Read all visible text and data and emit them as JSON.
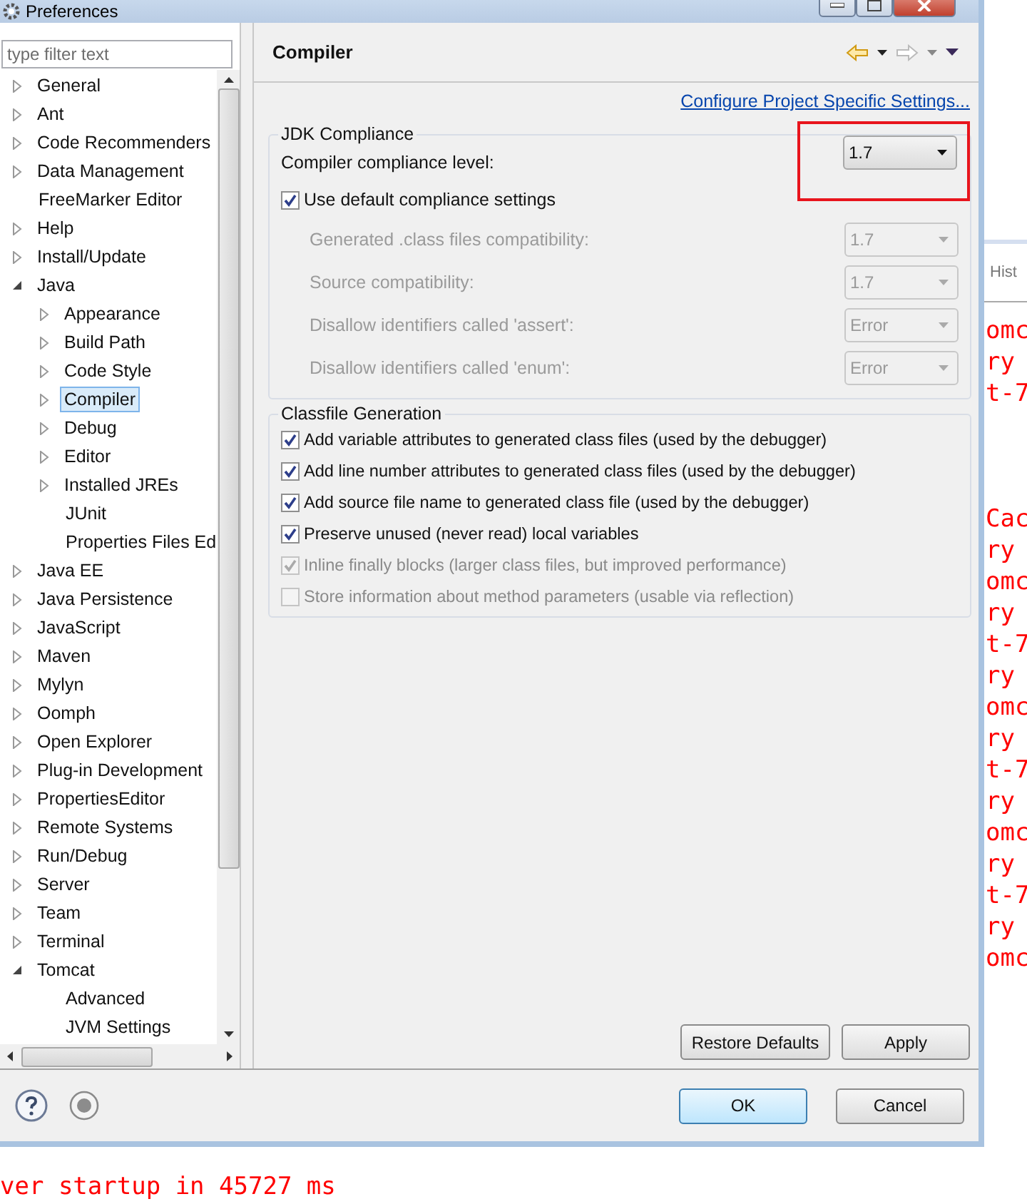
{
  "window": {
    "title": "Preferences"
  },
  "filter": {
    "placeholder": "type filter text"
  },
  "tree": [
    {
      "label": "General",
      "expanded": false,
      "selected": false
    },
    {
      "label": "Ant",
      "expanded": false,
      "selected": false
    },
    {
      "label": "Code Recommenders",
      "expanded": false,
      "selected": false
    },
    {
      "label": "Data Management",
      "expanded": false,
      "selected": false
    },
    {
      "label": "FreeMarker Editor",
      "selected": false
    },
    {
      "label": "Help",
      "expanded": false,
      "selected": false
    },
    {
      "label": "Install/Update",
      "expanded": false,
      "selected": false
    },
    {
      "label": "Java",
      "expanded": true,
      "selected": false,
      "children": [
        {
          "label": "Appearance",
          "expanded": false,
          "selected": false
        },
        {
          "label": "Build Path",
          "expanded": false,
          "selected": false
        },
        {
          "label": "Code Style",
          "expanded": false,
          "selected": false
        },
        {
          "label": "Compiler",
          "expanded": false,
          "selected": true
        },
        {
          "label": "Debug",
          "expanded": false,
          "selected": false
        },
        {
          "label": "Editor",
          "expanded": false,
          "selected": false
        },
        {
          "label": "Installed JREs",
          "expanded": false,
          "selected": false
        },
        {
          "label": "JUnit",
          "selected": false
        },
        {
          "label": "Properties Files Ed",
          "selected": false
        }
      ]
    },
    {
      "label": "Java EE",
      "expanded": false,
      "selected": false
    },
    {
      "label": "Java Persistence",
      "expanded": false,
      "selected": false
    },
    {
      "label": "JavaScript",
      "expanded": false,
      "selected": false
    },
    {
      "label": "Maven",
      "expanded": false,
      "selected": false
    },
    {
      "label": "Mylyn",
      "expanded": false,
      "selected": false
    },
    {
      "label": "Oomph",
      "expanded": false,
      "selected": false
    },
    {
      "label": "Open Explorer",
      "expanded": false,
      "selected": false
    },
    {
      "label": "Plug-in Development",
      "expanded": false,
      "selected": false
    },
    {
      "label": "PropertiesEditor",
      "expanded": false,
      "selected": false
    },
    {
      "label": "Remote Systems",
      "expanded": false,
      "selected": false
    },
    {
      "label": "Run/Debug",
      "expanded": false,
      "selected": false
    },
    {
      "label": "Server",
      "expanded": false,
      "selected": false
    },
    {
      "label": "Team",
      "expanded": false,
      "selected": false
    },
    {
      "label": "Terminal",
      "expanded": false,
      "selected": false
    },
    {
      "label": "Tomcat",
      "expanded": true,
      "selected": false,
      "children": [
        {
          "label": "Advanced",
          "selected": false
        },
        {
          "label": "JVM Settings",
          "selected": false
        }
      ]
    }
  ],
  "page": {
    "title": "Compiler",
    "link": "Configure Project Specific Settings..."
  },
  "jdk_compliance": {
    "title": "JDK Compliance",
    "level": {
      "label": "Compiler compliance level:",
      "value": "1.7",
      "disabled": false,
      "highlighted": true
    },
    "use_default": {
      "label": "Use default compliance settings",
      "checked": true,
      "disabled": false
    },
    "settings": [
      {
        "label": "Generated .class files compatibility:",
        "value": "1.7",
        "disabled": true
      },
      {
        "label": "Source compatibility:",
        "value": "1.7",
        "disabled": true
      },
      {
        "label": "Disallow identifiers called 'assert':",
        "value": "Error",
        "disabled": true
      },
      {
        "label": "Disallow identifiers called 'enum':",
        "value": "Error",
        "disabled": true
      }
    ]
  },
  "classfile_generation": {
    "title": "Classfile Generation",
    "options": [
      {
        "label": "Add variable attributes to generated class files (used by the debugger)",
        "checked": true,
        "disabled": false
      },
      {
        "label": "Add line number attributes to generated class files (used by the debugger)",
        "checked": true,
        "disabled": false
      },
      {
        "label": "Add source file name to generated class file (used by the debugger)",
        "checked": true,
        "disabled": false
      },
      {
        "label": "Preserve unused (never read) local variables",
        "checked": true,
        "disabled": false
      },
      {
        "label": "Inline finally blocks (larger class files, but improved performance)",
        "checked": true,
        "disabled": true
      },
      {
        "label": "Store information about method parameters (usable via reflection)",
        "checked": false,
        "disabled": true
      }
    ]
  },
  "page_buttons": [
    "Restore Defaults",
    "Apply"
  ],
  "dialog_buttons": [
    "OK",
    "Cancel"
  ],
  "background": {
    "tab": "Hist",
    "console_lines_top": [
      "omc",
      "ry",
      "t-7"
    ],
    "console_lines": [
      "Cac",
      "ry",
      "omc",
      "ry",
      "t-7",
      "ry",
      "omc",
      "ry",
      "t-7",
      "ry",
      "omc",
      "ry",
      "t-7",
      "ry",
      "omc"
    ],
    "bottom_line": "ver startup in 45727 ms"
  }
}
